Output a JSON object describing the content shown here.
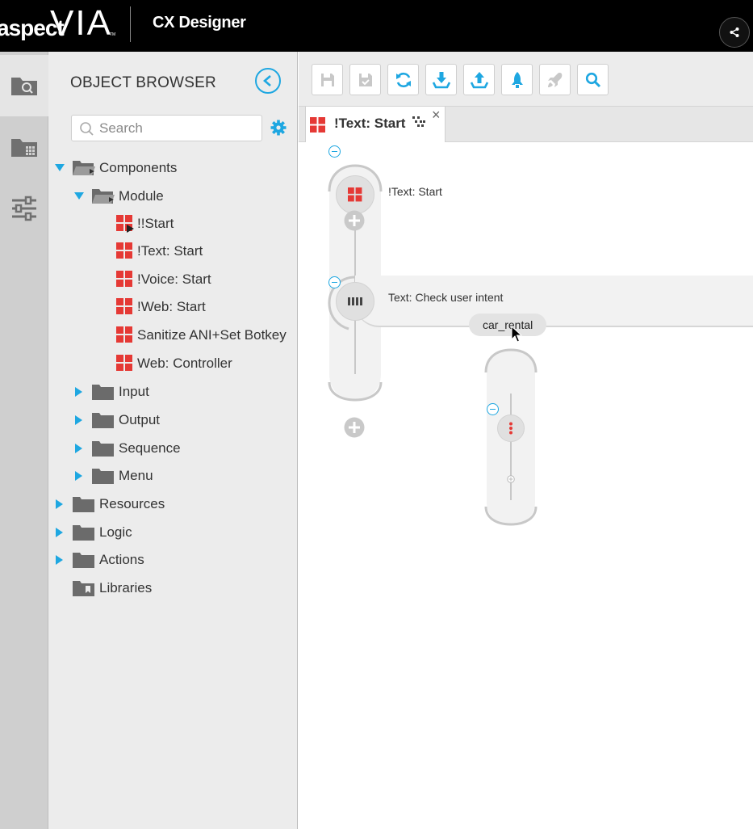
{
  "header": {
    "logo_aspect": "aspect",
    "logo_via": "VIA",
    "logo_tm": "TM",
    "app_title": "CX Designer"
  },
  "browser": {
    "title": "OBJECT BROWSER",
    "search_placeholder": "Search",
    "tree": [
      {
        "label": "Components",
        "level": 0,
        "type": "folder-open",
        "expanded": true
      },
      {
        "label": "Module",
        "level": 1,
        "type": "folder-open",
        "expanded": true
      },
      {
        "label": "!!Start",
        "level": 2,
        "type": "module-start"
      },
      {
        "label": "!Text: Start",
        "level": 2,
        "type": "module"
      },
      {
        "label": "!Voice: Start",
        "level": 2,
        "type": "module"
      },
      {
        "label": "!Web: Start",
        "level": 2,
        "type": "module"
      },
      {
        "label": "Sanitize ANI+Set Botkey",
        "level": 2,
        "type": "module"
      },
      {
        "label": "Web: Controller",
        "level": 2,
        "type": "module"
      },
      {
        "label": "Input",
        "level": 1,
        "type": "folder",
        "expanded": false
      },
      {
        "label": "Output",
        "level": 1,
        "type": "folder",
        "expanded": false
      },
      {
        "label": "Sequence",
        "level": 1,
        "type": "folder",
        "expanded": false
      },
      {
        "label": "Menu",
        "level": 1,
        "type": "folder",
        "expanded": false
      },
      {
        "label": "Resources",
        "level": 0,
        "type": "folder",
        "expanded": false
      },
      {
        "label": "Logic",
        "level": 0,
        "type": "folder",
        "expanded": false
      },
      {
        "label": "Actions",
        "level": 0,
        "type": "folder",
        "expanded": false
      },
      {
        "label": "Libraries",
        "level": 0,
        "type": "library"
      }
    ]
  },
  "toolbar": {
    "buttons": [
      "save-icon",
      "save-as-icon",
      "refresh-icon",
      "import-icon",
      "export-icon",
      "deploy-icon",
      "rocket-icon",
      "search-icon"
    ]
  },
  "tab": {
    "label": "!Text: Start",
    "close": "×"
  },
  "flow": {
    "node1_label": "!Text: Start",
    "node2_label": "Text: Check user intent",
    "branch_label": "car_rental"
  },
  "colors": {
    "accent": "#1ea7e1",
    "module_red": "#e53935",
    "header_bg": "#000000"
  }
}
